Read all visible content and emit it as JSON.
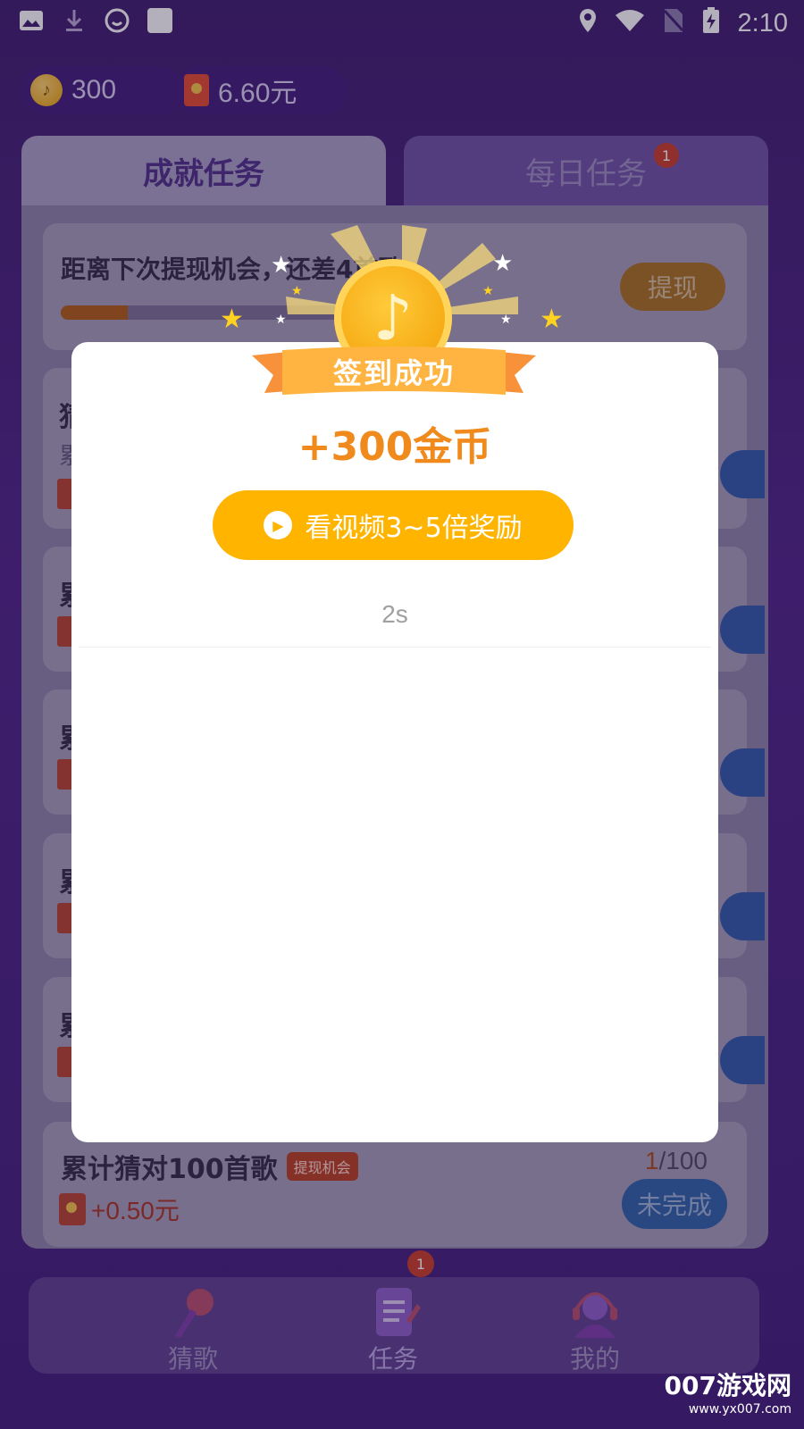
{
  "status_bar": {
    "time": "2:10"
  },
  "balances": {
    "coins": "300",
    "cash": "6.60元"
  },
  "tabs": [
    {
      "label": "成就任务",
      "active": true
    },
    {
      "label": "每日任务",
      "active": false,
      "badge": "1"
    }
  ],
  "progress_card": {
    "text": "距离下次提现机会，还差4首歌",
    "button": "提现",
    "progress": 0.22
  },
  "partial_cards": [
    {
      "title_initial": "猜",
      "sub_initial": "累"
    },
    {
      "title_initial": "累"
    },
    {
      "title_initial": "累"
    },
    {
      "title_initial": "累"
    },
    {
      "title_initial": "累"
    }
  ],
  "last_task": {
    "title": "累计猜对100首歌",
    "tag": "提现机会",
    "reward": "+0.50元",
    "progress_done": "1",
    "progress_total": "/100",
    "button": "未完成"
  },
  "modal": {
    "banner": "签到成功",
    "amount": "+300金币",
    "video_button": "看视频3~5倍奖励",
    "countdown": "2s"
  },
  "bottom_nav": [
    {
      "label": "猜歌",
      "icon": "microphone-icon"
    },
    {
      "label": "任务",
      "icon": "task-list-icon",
      "badge": "1"
    },
    {
      "label": "我的",
      "icon": "profile-headphones-icon"
    }
  ],
  "watermark": {
    "brand": "007游戏网",
    "url": "www.yx007.com"
  },
  "colors": {
    "accent_orange": "#f08a1c",
    "button_yellow": "#ffb400",
    "purple_bg": "#4a1f86"
  }
}
